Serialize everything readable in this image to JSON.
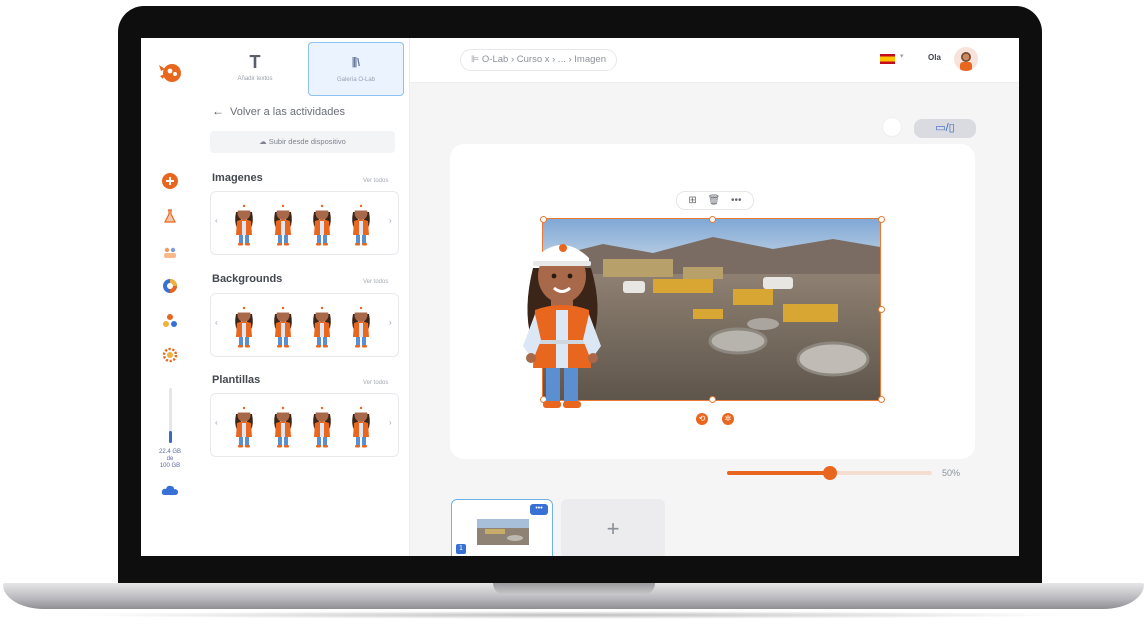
{
  "app": {
    "brand_color": "#e9661f",
    "accent_color": "#3970d6"
  },
  "rail": {
    "icons": [
      "add-icon",
      "flask-icon",
      "users-icon",
      "chart-icon",
      "palette-icon",
      "gear-icon"
    ],
    "storage": {
      "used": "22.4 GB",
      "de": "de",
      "total": "100 GB",
      "fraction": 0.224
    }
  },
  "panel": {
    "tabs": [
      {
        "label": "Añadir textos",
        "icon": "T"
      },
      {
        "label": "Galería O-Lab",
        "icon": "⫼\\",
        "active": true
      }
    ],
    "back_label": "Volver a las actividades",
    "upload_label": "Subir desde dispositivo",
    "sections": [
      {
        "title": "Imagenes",
        "see_all": "Ver todos"
      },
      {
        "title": "Backgrounds",
        "see_all": "Ver todos"
      },
      {
        "title": "Plantillas",
        "see_all": "Ver todos"
      }
    ],
    "prev_glyph": "‹",
    "next_glyph": "›"
  },
  "topbar": {
    "breadcrumb": "⊫ O-Lab › Curso x › ... › Imagen",
    "language": "ES",
    "user_name": "Ola"
  },
  "workspace": {
    "view_toggle": "▭/▯",
    "image_tools": "⊞ 🗑 •••",
    "zoom": {
      "value": "50%",
      "fraction": 0.5
    },
    "slides": [
      {
        "number": "1",
        "more": "•••"
      }
    ],
    "add_slide": "+"
  }
}
